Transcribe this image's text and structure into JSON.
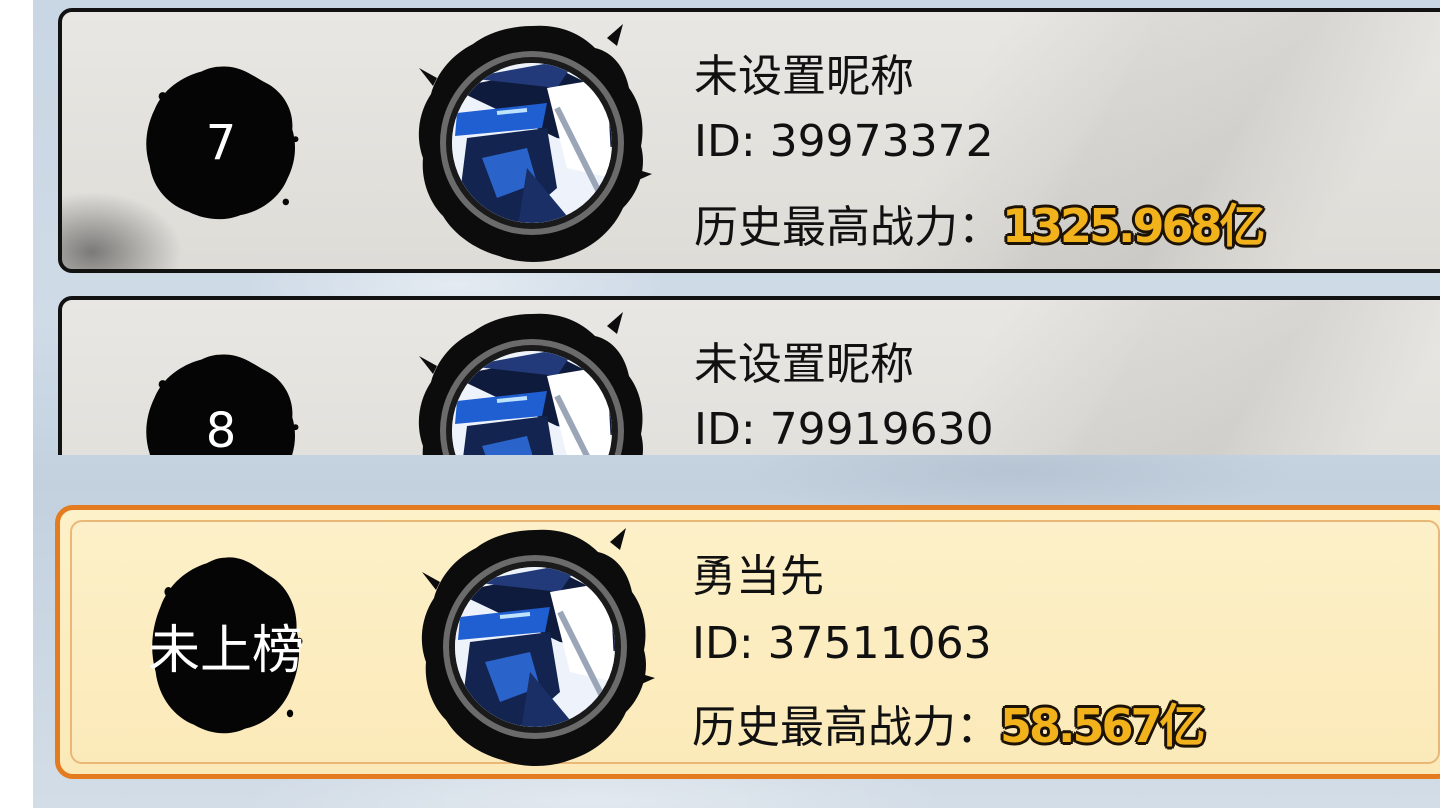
{
  "leaderboard": {
    "rows": [
      {
        "rank": "7",
        "nickname": "未设置昵称",
        "id_text": "ID: 39973372",
        "power_label": "历史最高战力：",
        "power_value": "1325.968亿"
      },
      {
        "rank": "8",
        "nickname": "未设置昵称",
        "id_text": "ID: 79919630"
      }
    ]
  },
  "my_rank": {
    "rank": "未上榜",
    "nickname": "勇当先",
    "id_text": "ID: 37511063",
    "power_label": "历史最高战力：",
    "power_value": "58.567亿"
  },
  "colors": {
    "highlight_border": "#e47b1e",
    "highlight_bg": "#fdf1c9",
    "power_fill": "#f1b21c",
    "row_border": "#121212"
  },
  "icons": {
    "rank_badge": "ink-blot-icon",
    "avatar": "ninja-avatar-icon"
  }
}
